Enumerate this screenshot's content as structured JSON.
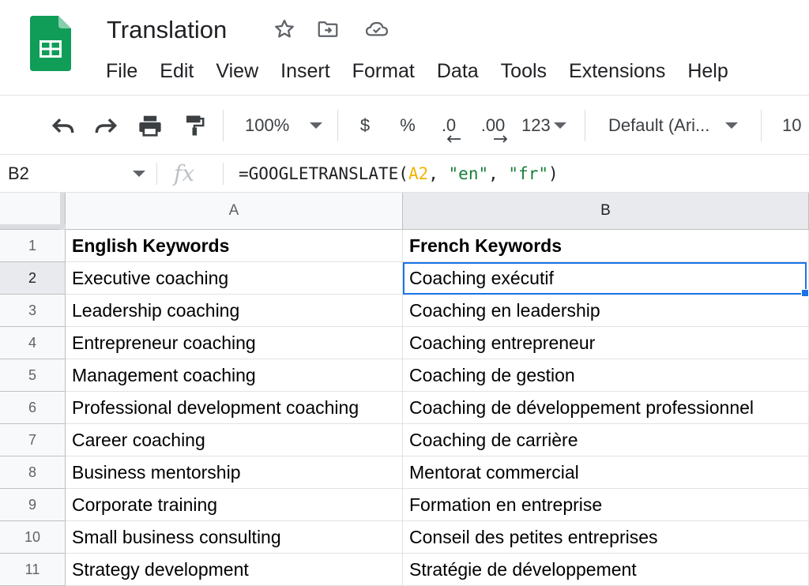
{
  "app": {
    "title": "Translation",
    "icons": [
      "sheets-logo-icon",
      "star-icon",
      "move-to-folder-icon",
      "cloud-saved-icon"
    ]
  },
  "menu": [
    "File",
    "Edit",
    "View",
    "Insert",
    "Format",
    "Data",
    "Tools",
    "Extensions",
    "Help"
  ],
  "toolbar": {
    "zoom": "100%",
    "currency": "$",
    "percent": "%",
    "decrease_decimal": ".0",
    "increase_decimal": ".00",
    "more_formats": "123",
    "font": "Default (Ari...",
    "font_size": "10",
    "icons": [
      "undo-icon",
      "redo-icon",
      "print-icon",
      "paint-format-icon"
    ]
  },
  "formula_bar": {
    "cell_ref": "B2",
    "fx": "fx",
    "formula_start": "=GOOGLETRANSLATE(",
    "formula_ref": "A2",
    "formula_sep1": ", ",
    "formula_src": "\"en\"",
    "formula_sep2": ", ",
    "formula_tgt": "\"fr\"",
    "formula_end": ")"
  },
  "grid": {
    "columns": [
      "A",
      "B"
    ],
    "rows": [
      {
        "num": "1",
        "a": "English Keywords",
        "b": "French Keywords"
      },
      {
        "num": "2",
        "a": "Executive coaching",
        "b": "Coaching exécutif"
      },
      {
        "num": "3",
        "a": "Leadership coaching",
        "b": "Coaching en leadership"
      },
      {
        "num": "4",
        "a": "Entrepreneur coaching",
        "b": "Coaching entrepreneur"
      },
      {
        "num": "5",
        "a": "Management coaching",
        "b": "Coaching de gestion"
      },
      {
        "num": "6",
        "a": "Professional development coaching",
        "b": "Coaching de développement professionnel"
      },
      {
        "num": "7",
        "a": "Career coaching",
        "b": "Coaching de carrière"
      },
      {
        "num": "8",
        "a": "Business mentorship",
        "b": "Mentorat commercial"
      },
      {
        "num": "9",
        "a": "Corporate training",
        "b": "Formation en entreprise"
      },
      {
        "num": "10",
        "a": "Small business consulting",
        "b": "Conseil des petites entreprises"
      },
      {
        "num": "11",
        "a": "Strategy development",
        "b": "Stratégie de développement"
      }
    ],
    "selected_cell": "B2"
  },
  "colors": {
    "accent": "#1a73e8",
    "sheets_green": "#0f9d58",
    "formula_ref": "#f4b400",
    "formula_string": "#188038"
  }
}
